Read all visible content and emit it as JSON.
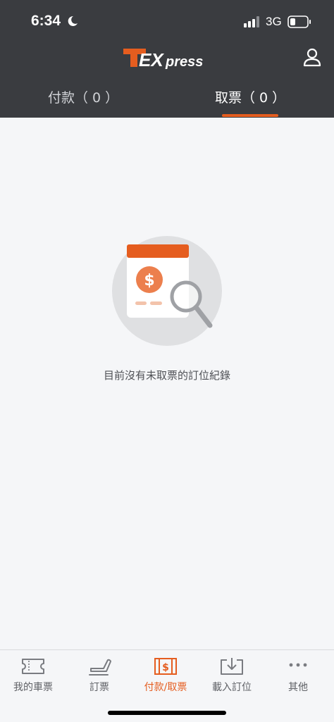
{
  "status_bar": {
    "time": "6:34",
    "network": "3G"
  },
  "header": {
    "brand": "TEXpress"
  },
  "tabs": [
    {
      "label": "付款（ 0 ）",
      "active": false
    },
    {
      "label": "取票（ 0 ）",
      "active": true
    }
  ],
  "empty_state": {
    "message": "目前沒有未取票的訂位紀錄"
  },
  "bottom_nav": [
    {
      "label": "我的車票",
      "icon": "ticket-icon",
      "active": false
    },
    {
      "label": "訂票",
      "icon": "seat-icon",
      "active": false
    },
    {
      "label": "付款/取票",
      "icon": "dollar-ticket-icon",
      "active": true
    },
    {
      "label": "載入訂位",
      "icon": "download-icon",
      "active": false
    },
    {
      "label": "其他",
      "icon": "more-icon",
      "active": false
    }
  ],
  "colors": {
    "accent": "#e55d1f",
    "header_bg": "#3a3c40",
    "page_bg": "#f5f6f8"
  }
}
